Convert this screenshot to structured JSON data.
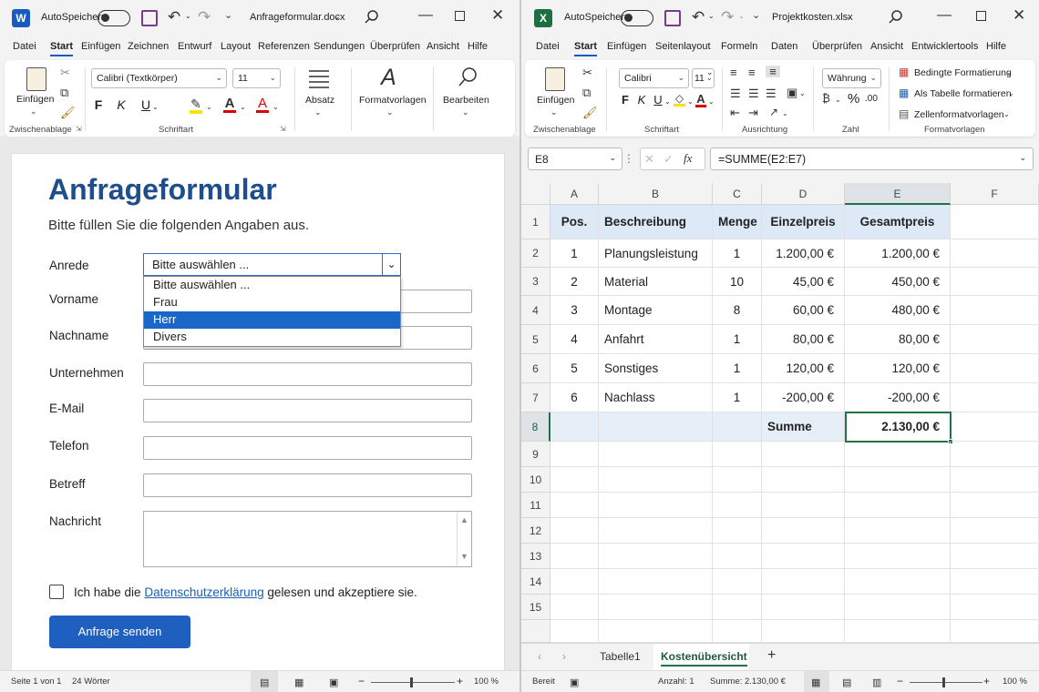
{
  "word": {
    "title": "Anfrageformular.docx",
    "autosave_label": "AutoSpeichern",
    "menu": [
      "Datei",
      "Start",
      "Einfügen",
      "Zeichnen",
      "Entwurf",
      "Layout",
      "Referenzen",
      "Sendungen",
      "Überprüfen",
      "Ansicht",
      "Hilfe"
    ],
    "ribbon": {
      "paste_label": "Einfügen",
      "clipboard_group": "Zwischenablage",
      "font_name": "Calibri (Textkörper)",
      "font_size": "11",
      "font_group": "Schriftart",
      "bold": "F",
      "italic": "K",
      "underline": "U",
      "paragraph_label": "Absatz",
      "styles_label": "Formatvorlagen",
      "edit_label": "Bearbeiten"
    },
    "form": {
      "title": "Anfrageformular",
      "subtitle": "Bitte füllen Sie die folgenden Angaben aus.",
      "salutation_label": "Anrede",
      "salutation_value": "Bitte auswählen ...",
      "salutation_options": [
        "Bitte auswählen ...",
        "Frau",
        "Herr",
        "Divers"
      ],
      "highlighted_option": "Herr",
      "fields": [
        "Vorname",
        "Nachname",
        "Unternehmen",
        "E-Mail",
        "Telefon",
        "Betreff",
        "Nachricht"
      ],
      "consent_before": "Ich habe die",
      "consent_link": "Datenschutzerklärung",
      "consent_after": "gelesen und akzeptiere sie.",
      "submit_label": "Anfrage senden"
    },
    "status": {
      "page": "Seite 1 von 1",
      "words": "24 Wörter",
      "zoom": "100 %"
    }
  },
  "excel": {
    "title": "Projektkosten.xlsx",
    "autosave_label": "AutoSpeichern",
    "menu": [
      "Datei",
      "Start",
      "Einfügen",
      "Seitenlayout",
      "Formeln",
      "Daten",
      "Überprüfen",
      "Ansicht",
      "Entwicklertools",
      "Hilfe"
    ],
    "ribbon": {
      "paste_label": "Einfügen",
      "clipboard_group": "Zwischenablage",
      "font_name": "Calibri",
      "font_size": "11",
      "font_group": "Schriftart",
      "bold": "F",
      "italic": "K",
      "underline": "U",
      "alignment_group": "Ausrichtung",
      "number_format": "Währung",
      "number_group": "Zahl",
      "percent": "%",
      "decimals": ".00",
      "cond_format": "Bedingte Formatierung",
      "as_table": "Als Tabelle formatieren",
      "cell_styles": "Zellenformatvorlagen",
      "styles_group": "Formatvorlagen"
    },
    "name_box": "E8",
    "formula": "=SUMME(E2:E7)",
    "columns": [
      "A",
      "B",
      "C",
      "D",
      "E",
      "F"
    ],
    "row_numbers": [
      "1",
      "2",
      "3",
      "4",
      "5",
      "6",
      "7",
      "8",
      "9",
      "10",
      "11",
      "12",
      "13",
      "14",
      "15"
    ],
    "header_row": [
      "Pos.",
      "Beschreibung",
      "Menge",
      "Einzelpreis",
      "Gesamtpreis"
    ],
    "rows": [
      [
        "1",
        "Planungsleistung",
        "1",
        "1.200,00 €",
        "1.200,00 €"
      ],
      [
        "2",
        "Material",
        "10",
        "45,00 €",
        "450,00 €"
      ],
      [
        "3",
        "Montage",
        "8",
        "60,00 €",
        "480,00 €"
      ],
      [
        "4",
        "Anfahrt",
        "1",
        "80,00 €",
        "80,00 €"
      ],
      [
        "5",
        "Sonstiges",
        "1",
        "120,00 €",
        "120,00 €"
      ],
      [
        "6",
        "Nachlass",
        "1",
        "-200,00 €",
        "-200,00 €"
      ]
    ],
    "sum_label": "Summe",
    "sum_value": "2.130,00 €",
    "sheets": [
      "Tabelle1",
      "Kostenübersicht"
    ],
    "active_sheet": "Kostenübersicht",
    "status": {
      "mode": "Bereit",
      "count": "Anzahl: 1",
      "sum": "Summe: 2.130,00 €",
      "zoom": "100 %"
    }
  }
}
